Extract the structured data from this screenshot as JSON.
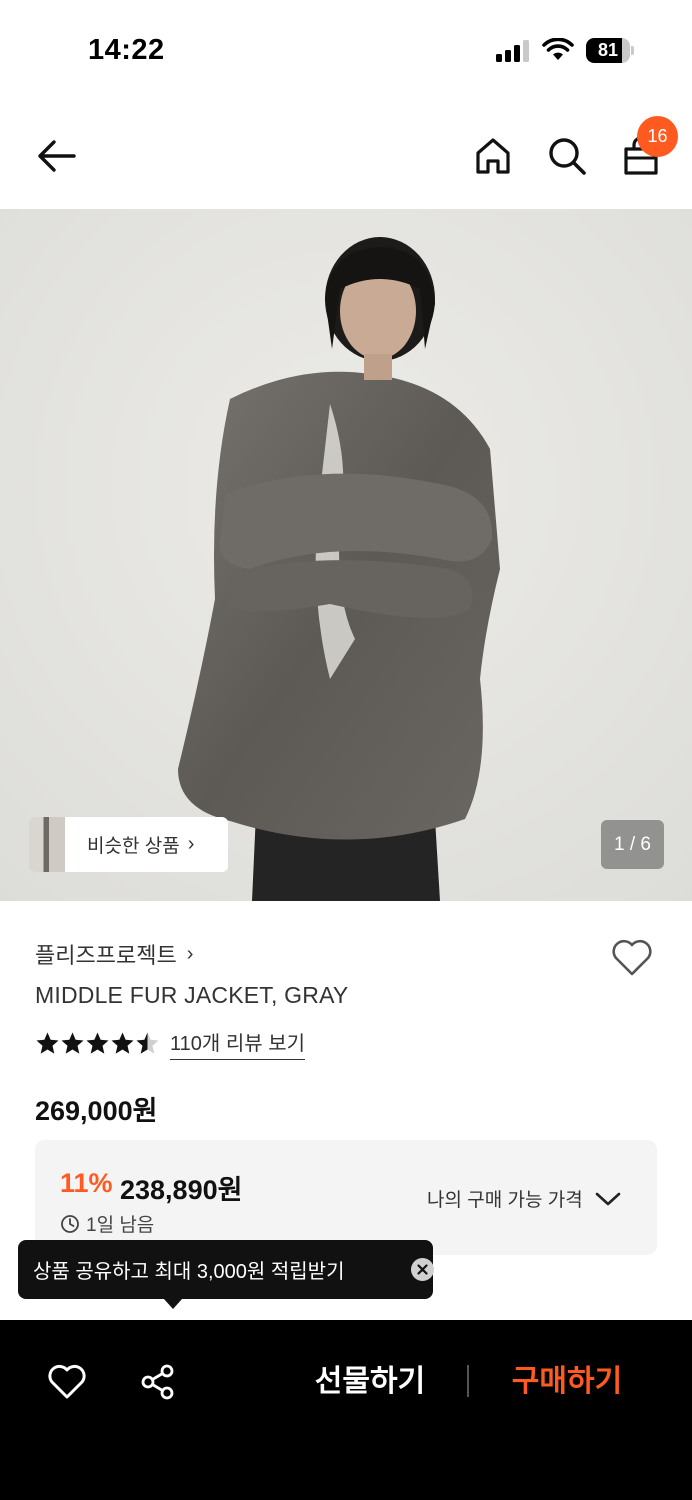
{
  "status_bar": {
    "time": "14:22",
    "battery": "81",
    "battery_level": 0.81
  },
  "nav": {
    "cart_count": "16",
    "icons": [
      "back-arrow-icon",
      "home-icon",
      "search-icon",
      "shopping-bag-icon"
    ]
  },
  "hero": {
    "similar_label": "비슷한 상품",
    "page_indicator": "1 / 6"
  },
  "product": {
    "brand": "플리즈프로젝트",
    "title": "MIDDLE FUR JACKET, GRAY",
    "rating": 4.5,
    "review_link": "110개 리뷰 보기",
    "price": "269,000원",
    "discount_rate": "11%",
    "discount_price": "238,890원",
    "time_left": "1일 남음",
    "my_price_label": "나의 구매 가능 가격"
  },
  "tooltip": {
    "text": "상품 공유하고 최대 3,000원 적립받기"
  },
  "bottom_bar": {
    "gift_label": "선물하기",
    "buy_label": "구매하기"
  },
  "colors": {
    "accent": "#ff5a1f",
    "bottom_bar_bg": "#000000",
    "price_box_bg": "#f4f4f4"
  }
}
